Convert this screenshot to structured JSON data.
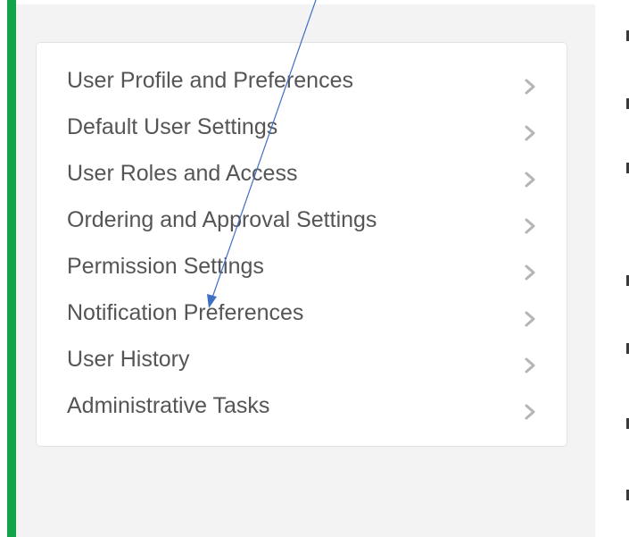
{
  "menu": {
    "items": [
      {
        "label": "User Profile and Preferences",
        "icon": "chevron-right-icon"
      },
      {
        "label": "Default User Settings",
        "icon": "chevron-right-icon"
      },
      {
        "label": "User Roles and Access",
        "icon": "chevron-right-icon"
      },
      {
        "label": "Ordering and Approval Settings",
        "icon": "chevron-right-icon"
      },
      {
        "label": "Permission Settings",
        "icon": "chevron-right-icon"
      },
      {
        "label": "Notification Preferences",
        "icon": "chevron-right-icon"
      },
      {
        "label": "User History",
        "icon": "chevron-right-icon"
      },
      {
        "label": "Administrative Tasks",
        "icon": "chevron-right-icon"
      }
    ]
  },
  "colors": {
    "accent": "#11a448",
    "panel_background": "#f3f3f3",
    "card_background": "#ffffff",
    "text": "#555555",
    "chevron": "#b5b5b5",
    "annotation_arrow": "#3f6fc4"
  }
}
